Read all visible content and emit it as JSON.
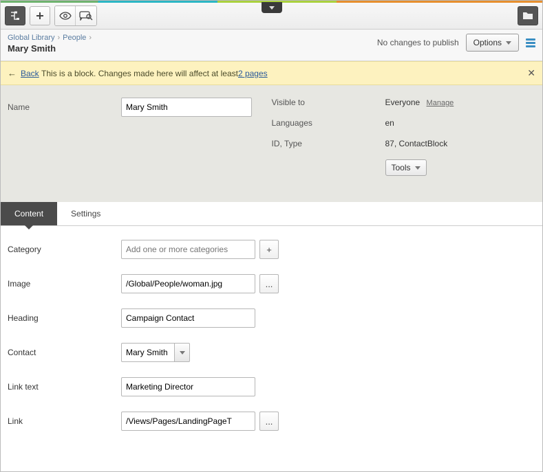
{
  "breadcrumb": {
    "root": "Global Library",
    "section": "People"
  },
  "page_title": "Mary Smith",
  "publish_status": "No changes to publish",
  "options_label": "Options",
  "banner": {
    "back": "Back",
    "text_before": "This is a block. Changes made here will affect at least ",
    "link": "2 pages"
  },
  "meta": {
    "name_label": "Name",
    "name_value": "Mary Smith",
    "visible_label": "Visible to",
    "visible_value": "Everyone",
    "manage": "Manage",
    "languages_label": "Languages",
    "languages_value": "en",
    "idtype_label": "ID, Type",
    "idtype_value": "87, ContactBlock",
    "tools": "Tools"
  },
  "tabs": {
    "content": "Content",
    "settings": "Settings"
  },
  "form": {
    "category_label": "Category",
    "category_placeholder": "Add one or more categories",
    "image_label": "Image",
    "image_value": "/Global/People/woman.jpg",
    "heading_label": "Heading",
    "heading_value": "Campaign Contact",
    "contact_label": "Contact",
    "contact_value": "Mary Smith",
    "linktext_label": "Link text",
    "linktext_value": "Marketing Director",
    "link_label": "Link",
    "link_value": "/Views/Pages/LandingPageT",
    "plus": "+",
    "ellipsis": "..."
  }
}
